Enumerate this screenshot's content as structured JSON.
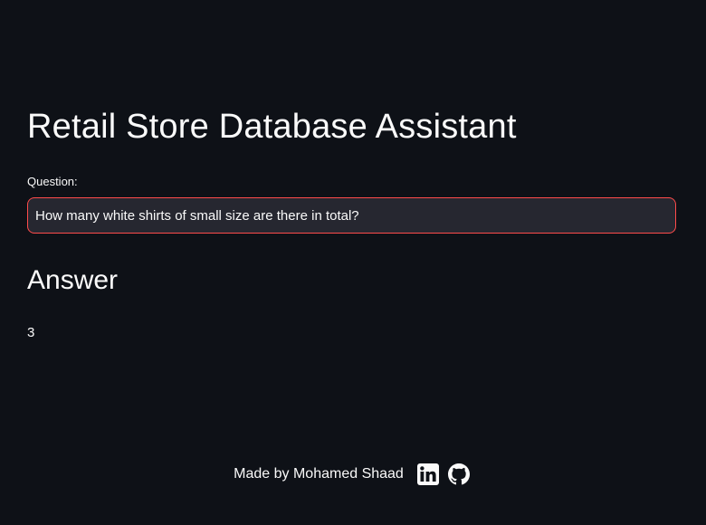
{
  "page": {
    "title": "Retail Store Database Assistant"
  },
  "question": {
    "label": "Question:",
    "value": "How many white shirts of small size are there in total?"
  },
  "answer": {
    "heading": "Answer",
    "value": "3"
  },
  "footer": {
    "text": "Made by Mohamed Shaad",
    "links": [
      {
        "icon": "linkedin-icon"
      },
      {
        "icon": "github-icon"
      }
    ]
  },
  "colors": {
    "background": "#0e1117",
    "input_background": "#262730",
    "focus_border": "#ff4b4b",
    "text": "#fafafa"
  }
}
